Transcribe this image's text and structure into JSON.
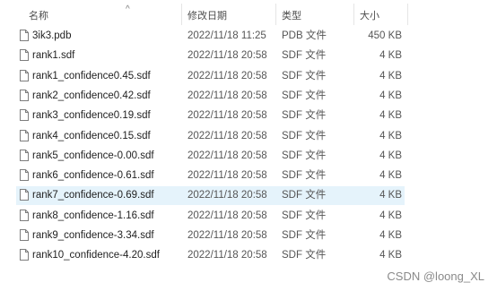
{
  "header": {
    "name": "名称",
    "modified": "修改日期",
    "type": "类型",
    "size": "大小",
    "sort_arrow": "^"
  },
  "files": [
    {
      "name": "3ik3.pdb",
      "modified": "2022/11/18 11:25",
      "type": "PDB 文件",
      "size": "450 KB",
      "selected": false
    },
    {
      "name": "rank1.sdf",
      "modified": "2022/11/18 20:58",
      "type": "SDF 文件",
      "size": "4 KB",
      "selected": false
    },
    {
      "name": "rank1_confidence0.45.sdf",
      "modified": "2022/11/18 20:58",
      "type": "SDF 文件",
      "size": "4 KB",
      "selected": false
    },
    {
      "name": "rank2_confidence0.42.sdf",
      "modified": "2022/11/18 20:58",
      "type": "SDF 文件",
      "size": "4 KB",
      "selected": false
    },
    {
      "name": "rank3_confidence0.19.sdf",
      "modified": "2022/11/18 20:58",
      "type": "SDF 文件",
      "size": "4 KB",
      "selected": false
    },
    {
      "name": "rank4_confidence0.15.sdf",
      "modified": "2022/11/18 20:58",
      "type": "SDF 文件",
      "size": "4 KB",
      "selected": false
    },
    {
      "name": "rank5_confidence-0.00.sdf",
      "modified": "2022/11/18 20:58",
      "type": "SDF 文件",
      "size": "4 KB",
      "selected": false
    },
    {
      "name": "rank6_confidence-0.61.sdf",
      "modified": "2022/11/18 20:58",
      "type": "SDF 文件",
      "size": "4 KB",
      "selected": false
    },
    {
      "name": "rank7_confidence-0.69.sdf",
      "modified": "2022/11/18 20:58",
      "type": "SDF 文件",
      "size": "4 KB",
      "selected": true
    },
    {
      "name": "rank8_confidence-1.16.sdf",
      "modified": "2022/11/18 20:58",
      "type": "SDF 文件",
      "size": "4 KB",
      "selected": false
    },
    {
      "name": "rank9_confidence-3.34.sdf",
      "modified": "2022/11/18 20:58",
      "type": "SDF 文件",
      "size": "4 KB",
      "selected": false
    },
    {
      "name": "rank10_confidence-4.20.sdf",
      "modified": "2022/11/18 20:58",
      "type": "SDF 文件",
      "size": "4 KB",
      "selected": false
    }
  ],
  "watermark": "CSDN @loong_XL",
  "colors": {
    "selection": "#e5f3fb",
    "icon_border": "#7d7d7d"
  },
  "icons": {
    "file": "document-icon"
  }
}
